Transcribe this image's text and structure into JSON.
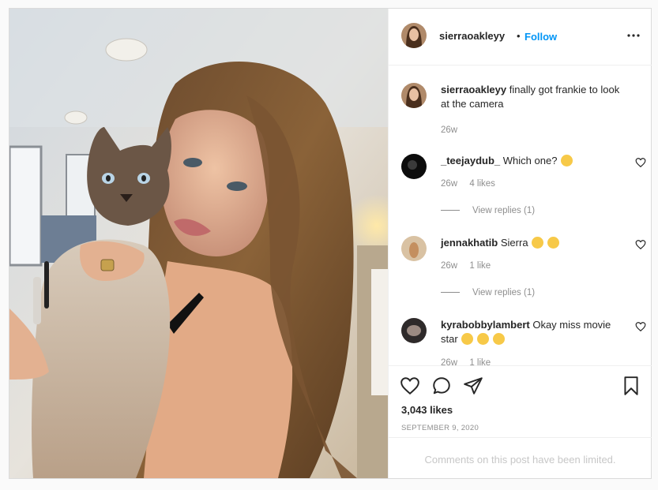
{
  "post": {
    "photo_alt": "Woman holding a Siamese cat",
    "author": {
      "username": "sierraoakleyy",
      "follow_label": "Follow",
      "separator": "•"
    },
    "more_icon": "more-horizontal-icon",
    "caption": {
      "username": "sierraoakleyy",
      "text": "finally got frankie to look at the camera",
      "time": "26w"
    },
    "comments": [
      {
        "username": "_teejaydub_",
        "text": "Which one?",
        "time": "26w",
        "likes": "4 likes",
        "view_replies": "View replies (1)"
      },
      {
        "username": "jennakhatib",
        "text": "Sierra",
        "time": "26w",
        "likes": "1 like",
        "view_replies": "View replies (1)"
      },
      {
        "username": "kyrabobbylambert",
        "text": "Okay miss movie star",
        "time": "26w",
        "likes": "1 like"
      }
    ],
    "likes_label": "3,043 likes",
    "date_label": "SEPTEMBER 9, 2020",
    "limited_label": "Comments on this post have been limited.",
    "colors": {
      "link_blue": "#0095f6",
      "muted": "#8e8e8e",
      "border": "#dbdbdb"
    }
  }
}
